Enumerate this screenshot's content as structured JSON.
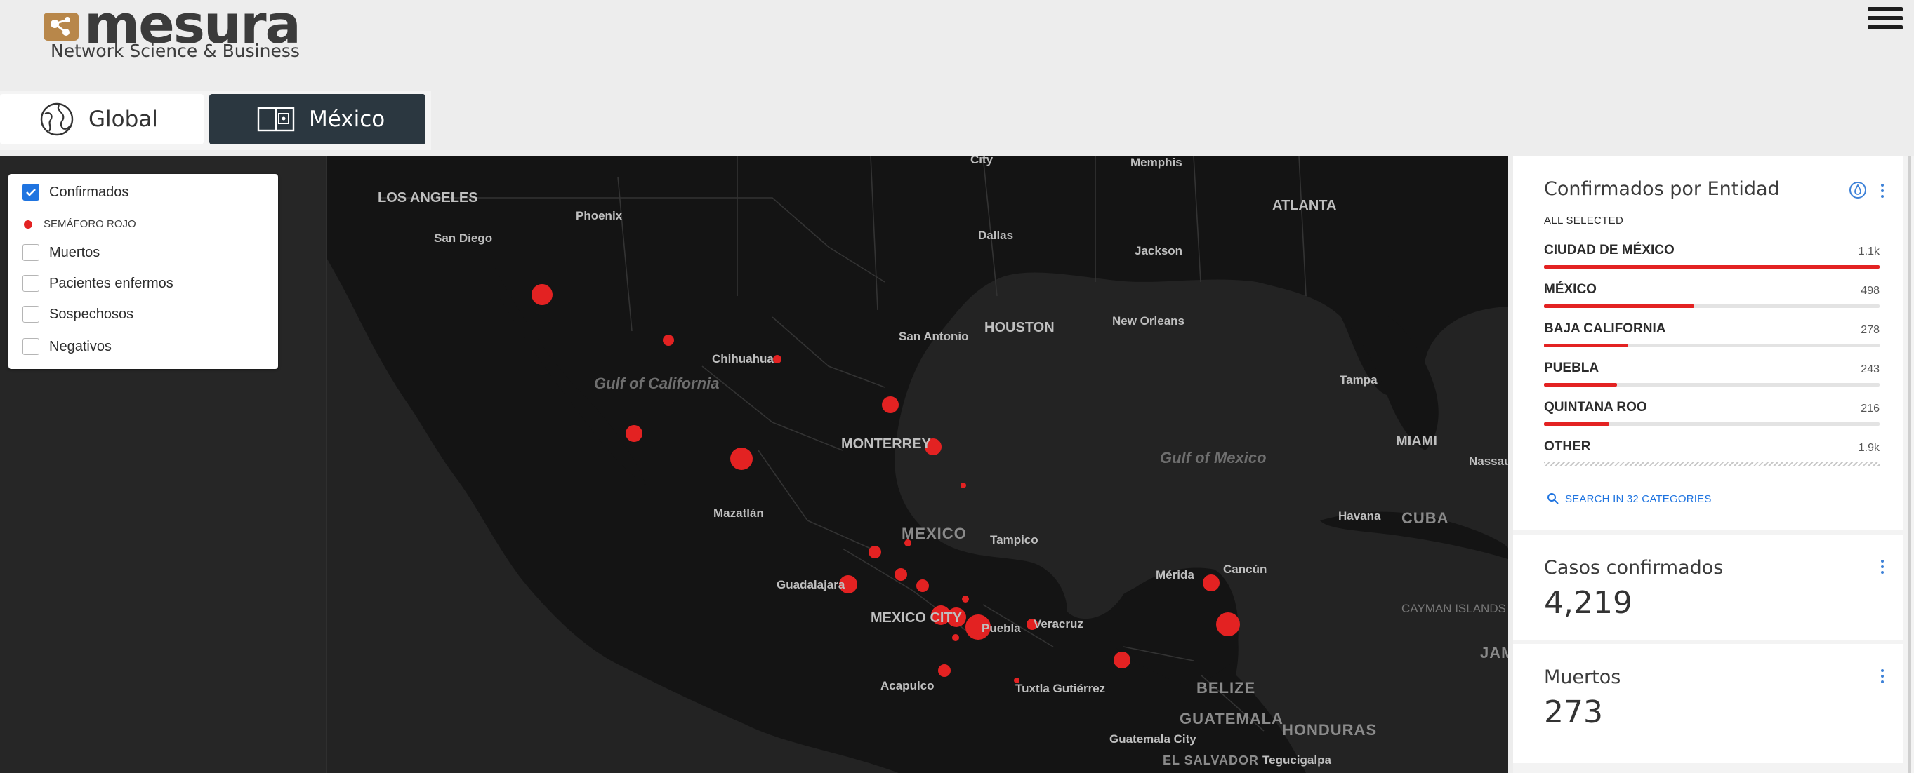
{
  "header": {
    "logo_word": "mesura",
    "logo_tagline": "Network Science & Business"
  },
  "tabs": [
    {
      "label": "Global",
      "icon": "globe-icon",
      "active": false
    },
    {
      "label": "México",
      "icon": "map-book-icon",
      "active": true
    }
  ],
  "layers": {
    "items": [
      {
        "label": "Confirmados",
        "checked": true
      },
      {
        "label": "Muertos",
        "checked": false
      },
      {
        "label": "Pacientes enfermos",
        "checked": false
      },
      {
        "label": "Sospechosos",
        "checked": false
      },
      {
        "label": "Negativos",
        "checked": false
      }
    ],
    "legend": {
      "label": "SEMÁFORO ROJO",
      "color": "#e32222"
    }
  },
  "map": {
    "labels": [
      "City",
      "Memphis",
      "LOS ANGELES",
      "Phoenix",
      "ATLANTA",
      "San Diego",
      "Dallas",
      "Jackson",
      "HOUSTON",
      "New Orleans",
      "San Antonio",
      "Chihuahua",
      "Gulf of California",
      "Tampa",
      "MIAMI",
      "Nassau",
      "MONTERREY",
      "Gulf of Mexico",
      "Mazatlán",
      "Havana",
      "CUBA",
      "MEXICO",
      "Tampico",
      "Mérida",
      "Cancún",
      "Guadalajara",
      "CAYMAN ISLANDS",
      "MEXICO CITY",
      "Puebla",
      "Veracruz",
      "JAM",
      "Acapulco",
      "Tuxtla Gutiérrez",
      "BELIZE",
      "GUATEMALA",
      "HONDURAS",
      "Guatemala City",
      "EL SALVADOR",
      "Tegucigalpa"
    ]
  },
  "card_entidad": {
    "title": "Confirmados por Entidad",
    "filter_label": "ALL SELECTED",
    "categories": [
      {
        "name": "CIUDAD DE MÉXICO",
        "value": "1.1k",
        "fraction": 1.0
      },
      {
        "name": "MÉXICO",
        "value": "498",
        "fraction": 0.447
      },
      {
        "name": "BAJA CALIFORNIA",
        "value": "278",
        "fraction": 0.25
      },
      {
        "name": "PUEBLA",
        "value": "243",
        "fraction": 0.218
      },
      {
        "name": "QUINTANA ROO",
        "value": "216",
        "fraction": 0.194
      },
      {
        "name": "OTHER",
        "value": "1.9k",
        "fraction": 1.0
      }
    ],
    "search_label": "SEARCH IN 32 CATEGORIES"
  },
  "card_casos": {
    "title": "Casos confirmados",
    "value": "4,219"
  },
  "card_muertos": {
    "title": "Muertos",
    "value": "273"
  },
  "colors": {
    "accent": "#1f74e0",
    "marker": "#e32222",
    "active_tab": "#2b3740"
  }
}
